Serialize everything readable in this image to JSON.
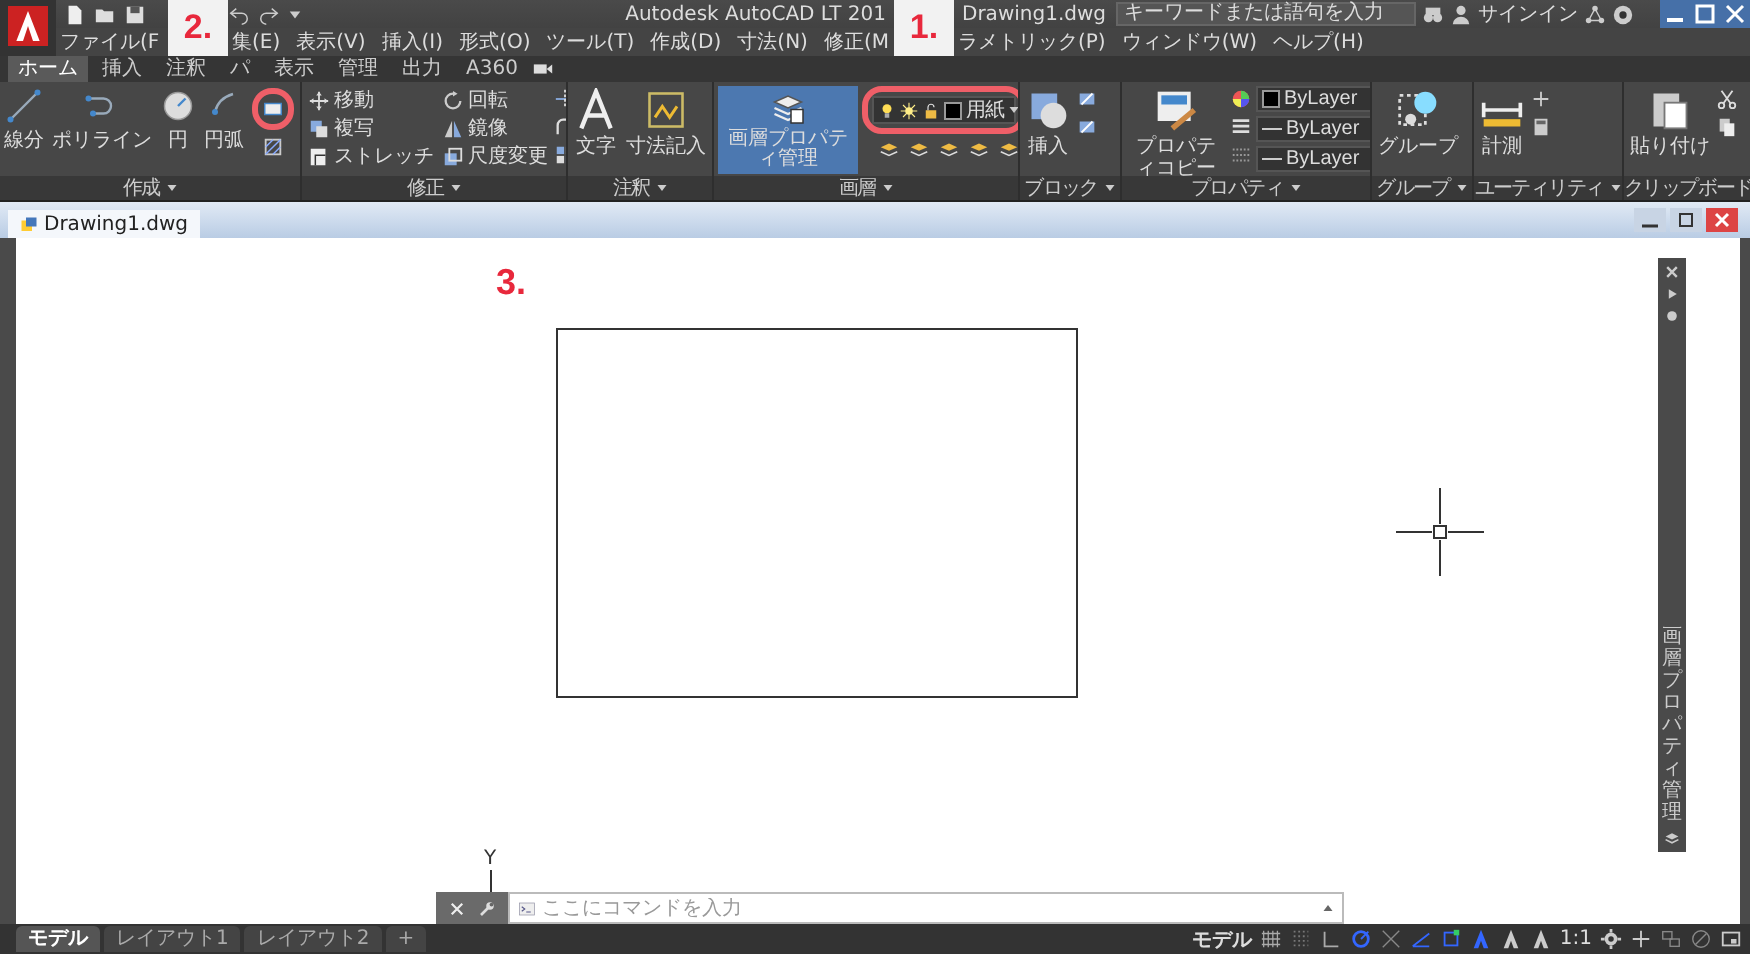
{
  "title_bar": {
    "title": "Autodesk AutoCAD LT 201",
    "document": "Drawing1.dwg",
    "search": {
      "placeholder": "キーワードまたは語句を入力"
    },
    "sign_in": "サインイン"
  },
  "markers": [
    {
      "label": "2."
    },
    {
      "label": "1."
    },
    {
      "label": "3."
    }
  ],
  "menu_bar": [
    [
      "ファイル(F"
    ],
    [
      "集(E)",
      "表示(V)",
      "挿入(I)",
      "形式(O)",
      "ツール(T)",
      "作成(D)",
      "寸法(N)",
      "修正(M"
    ],
    [
      "ラメトリック(P)",
      "ウィンドウ(W)",
      "ヘルプ(H)"
    ]
  ],
  "ribbon_tabs": [
    {
      "label": "ホーム",
      "selected": true
    },
    {
      "label": "挿入",
      "selected": false
    },
    {
      "label": "注釈",
      "selected": false
    },
    {
      "label": "パ",
      "selected": false
    },
    {
      "label": "表示",
      "selected": false
    },
    {
      "label": "管理",
      "selected": false
    },
    {
      "label": "出力",
      "selected": false
    },
    {
      "label": "A360",
      "selected": false
    }
  ],
  "panels": [
    {
      "kind": "draw",
      "title": "作成",
      "tools": [
        "線分",
        "ポリライン",
        "円",
        "円弧"
      ],
      "rectangle_highlighted": true
    },
    {
      "kind": "modify",
      "title": "修正",
      "tools": [
        "移動",
        "複写",
        "ストレッチ",
        "回転",
        "鏡像",
        "尺度変更"
      ]
    },
    {
      "kind": "annotate",
      "title": "注釈",
      "tools": [
        "文字",
        "寸法記入"
      ]
    },
    {
      "kind": "layers",
      "title": "画層",
      "tools": [
        "画層プロパティ管理"
      ],
      "layer": {
        "name": "用紙",
        "highlighted": true
      }
    },
    {
      "kind": "block",
      "title": "ブロック",
      "tools": [
        "挿入"
      ]
    },
    {
      "kind": "properties",
      "title": "プロパティ",
      "tools": [
        "プロパティコピー"
      ],
      "dropdowns": [
        "ByLayer",
        "ByLayer",
        "ByLayer"
      ]
    },
    {
      "kind": "group",
      "title": "グループ",
      "tools": [
        "グループ"
      ]
    },
    {
      "kind": "utilities",
      "title": "ユーティリティ",
      "tools": [
        "計測"
      ]
    },
    {
      "kind": "clipboard",
      "title": "クリップボード",
      "tools": [
        "貼り付け"
      ]
    }
  ],
  "document_tab": {
    "name": "Drawing1.dwg"
  },
  "palette": {
    "title": "画層プロパティ管理"
  },
  "ucs": {
    "axis": "Y"
  },
  "command_line": {
    "placeholder": "ここにコマンドを入力"
  },
  "layout_tabs": [
    {
      "label": "モデル",
      "selected": true
    },
    {
      "label": "レイアウト1",
      "selected": false
    },
    {
      "label": "レイアウト2",
      "selected": false
    }
  ],
  "add_tab": "+",
  "status_bar": {
    "space": "モデル",
    "scale": "1:1"
  }
}
